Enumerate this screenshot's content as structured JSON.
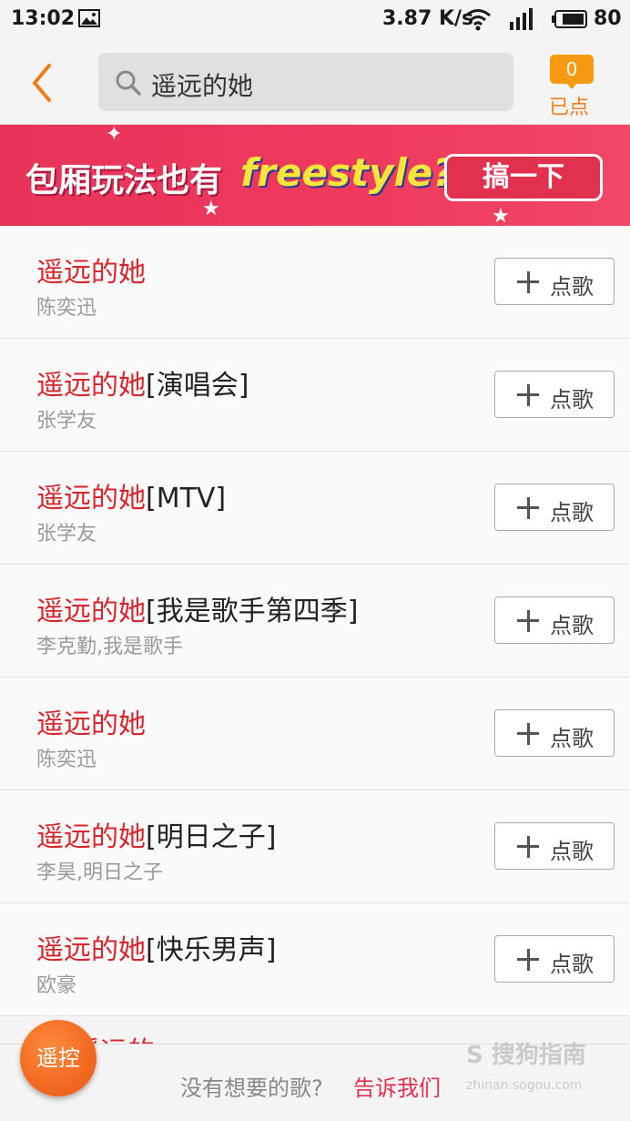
{
  "status_bar": {
    "time": "13:02",
    "speed": "3.87 K/s",
    "battery": "80"
  },
  "header": {
    "search_query": "遥远的她",
    "queue_count": "0",
    "queue_label": "已点"
  },
  "banner": {
    "text": "包厢玩法也有",
    "highlight": "freestyle?",
    "button": "搞一下"
  },
  "songs": [
    {
      "title": "遥远的她",
      "suffix": "",
      "artist": "陈奕迅"
    },
    {
      "title": "遥远的她",
      "suffix": "[演唱会]",
      "artist": "张学友"
    },
    {
      "title": "遥远的她",
      "suffix": "[MTV]",
      "artist": "张学友"
    },
    {
      "title": "遥远的她",
      "suffix": "[我是歌手第四季]",
      "artist": "李克勤,我是歌手"
    },
    {
      "title": "遥远的她",
      "suffix": "",
      "artist": "陈奕迅"
    },
    {
      "title": "遥远的她",
      "suffix": "[明日之子]",
      "artist": "李昊,明日之子"
    },
    {
      "title": "遥远的她",
      "suffix": "[快乐男声]",
      "artist": "欧豪"
    }
  ],
  "add_button_label": "点歌",
  "footer": {
    "prompt": "没有想要的歌?",
    "link": "告诉我们",
    "remote_button": "遥控"
  },
  "watermark": {
    "text": "S 搜狗指南",
    "url": "zhinan.sogou.com"
  },
  "colors": {
    "accent": "#f07b17",
    "highlight_red": "#d7262c",
    "banner": "#e8335b",
    "remote": "#f0641e"
  }
}
